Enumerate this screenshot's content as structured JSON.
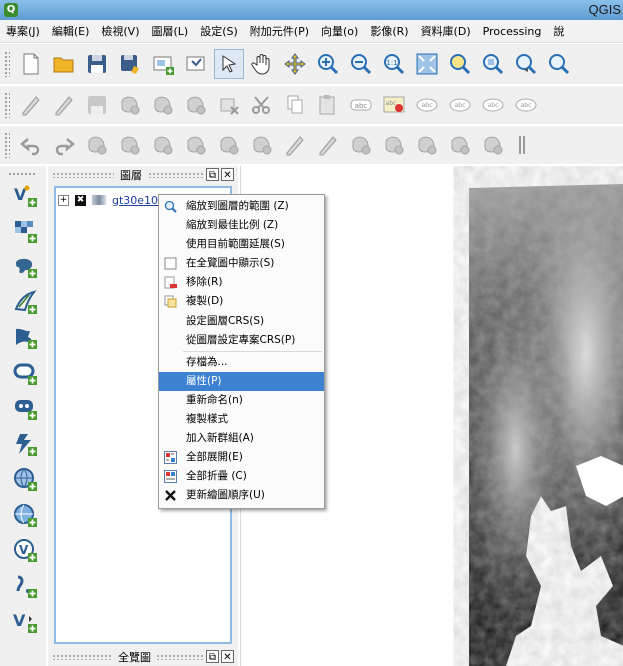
{
  "window": {
    "title": "QGIS",
    "app_icon": "qgis-logo-icon"
  },
  "menu": [
    {
      "label": "專案(J)"
    },
    {
      "label": "編輯(E)"
    },
    {
      "label": "檢視(V)"
    },
    {
      "label": "圖層(L)"
    },
    {
      "label": "設定(S)"
    },
    {
      "label": "附加元件(P)"
    },
    {
      "label": "向量(o)"
    },
    {
      "label": "影像(R)"
    },
    {
      "label": "資料庫(D)"
    },
    {
      "label": "Processing"
    },
    {
      "label": "說"
    }
  ],
  "toolbar1": [
    "new-project-icon",
    "open-project-icon",
    "save-project-icon",
    "save-as-icon",
    "new-print-composer-icon",
    "composer-manager-icon",
    "pan-map-to-selection-icon",
    "pan-icon",
    "pan-to-selection-icon",
    "zoom-in-icon",
    "zoom-out-icon",
    "zoom-actual-size-icon",
    "zoom-full-icon",
    "zoom-to-selection-icon",
    "zoom-to-layer-icon",
    "zoom-last-icon",
    "zoom-next-icon"
  ],
  "toolbar2": [
    "current-edits-icon",
    "toggle-editing-icon",
    "save-edits-icon",
    "add-feature-icon",
    "move-feature-icon",
    "node-tool-icon",
    "delete-selected-icon",
    "cut-features-icon",
    "copy-features-icon",
    "paste-features-icon",
    "label-icon",
    "label-pin-icon",
    "label-highlight-icon",
    "label-move-icon",
    "label-rotate-icon",
    "label-change-icon"
  ],
  "toolbar3": [
    "undo-icon",
    "redo-icon",
    "simplify-icon",
    "add-ring-icon",
    "add-part-icon",
    "fill-ring-icon",
    "delete-ring-icon",
    "delete-part-icon",
    "reshape-icon",
    "offset-curve-icon",
    "split-features-icon",
    "split-parts-icon",
    "merge-features-icon",
    "merge-attributes-icon",
    "rotate-point-symbols-icon",
    "grip-end-icon"
  ],
  "left_toolbar": [
    "add-vector-layer-icon",
    "add-raster-layer-icon",
    "add-postgis-layer-icon",
    "add-spatialite-layer-icon",
    "add-mssql-layer-icon",
    "add-oracle-layer-icon",
    "add-delimited-text-layer-icon",
    "add-wms-layer-icon",
    "add-wcs-layer-icon",
    "add-wfs-layer-icon",
    "add-virtual-layer-icon",
    "new-shapefile-layer-icon",
    "new-spatialite-layer-icon"
  ],
  "layers_panel": {
    "title": "圖層",
    "layer": {
      "name": "gt30e100n40",
      "checked": true,
      "check_mark": "✖",
      "expander": "+"
    }
  },
  "overview_panel": {
    "title": "全覽圖"
  },
  "panel_buttons": {
    "float": "⧉",
    "close": "✕"
  },
  "context_menu": {
    "items": [
      {
        "label": "縮放到圖層的範圍 (Z)",
        "icon": "zoom-to-layer-icon"
      },
      {
        "label": "縮放到最佳比例 (Z)",
        "icon": ""
      },
      {
        "label": "使用目前範圍延展(S)",
        "icon": ""
      },
      {
        "label": "在全覽圖中顯示(S)",
        "icon": "checkbox-icon"
      },
      {
        "label": "移除(R)",
        "icon": "remove-layer-icon"
      },
      {
        "label": "複製(D)",
        "icon": "duplicate-layer-icon"
      },
      {
        "label": "設定圖層CRS(S)",
        "icon": ""
      },
      {
        "label": "從圖層設定專案CRS(P)",
        "icon": ""
      },
      {
        "sep": true
      },
      {
        "label": "存檔為...",
        "icon": ""
      },
      {
        "label": "屬性(P)",
        "icon": "",
        "highlight": true
      },
      {
        "label": "重新命名(n)",
        "icon": ""
      },
      {
        "label": "複製樣式",
        "icon": ""
      },
      {
        "label": "加入新群組(A)",
        "icon": ""
      },
      {
        "label": "全部展開(E)",
        "icon": "expand-all-icon"
      },
      {
        "label": "全部折疊 (C)",
        "icon": "collapse-all-icon"
      },
      {
        "label": "更新繪圖順序(U)",
        "icon": "update-drawing-order-icon"
      }
    ]
  }
}
